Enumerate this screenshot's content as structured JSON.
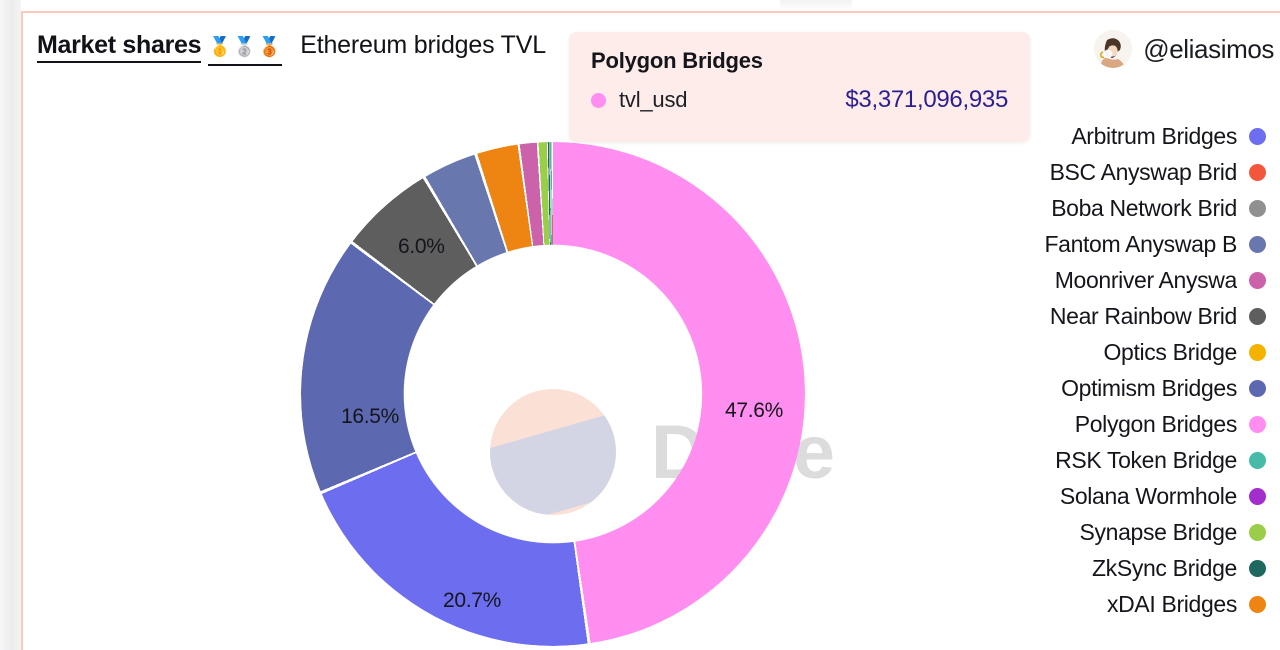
{
  "header": {
    "title_main": "Market shares",
    "title_medals": "🥇🥈🥉",
    "title_sub": "Ethereum bridges TVL",
    "author_handle": "@eliasimos"
  },
  "tooltip": {
    "title": "Polygon Bridges",
    "series_key": "tvl_usd",
    "series_dot_color": "#FF8EF0",
    "value": "$3,371,096,935"
  },
  "watermark": "Dune",
  "chart_data": {
    "type": "pie",
    "title": "Ethereum bridges TVL",
    "subtype": "donut",
    "value_label": "tvl_usd",
    "legend_position": "right",
    "categories": [
      "Polygon Bridges",
      "Arbitrum Bridges",
      "Optimism Bridges",
      "Near Rainbow Bridge",
      "Fantom Anyswap Bridge",
      "xDAI Bridges",
      "Moonriver Anyswap Bridge",
      "Synapse Bridge",
      "ZkSync Bridge",
      "RSK Token Bridge",
      "Boba Network Bridge",
      "BSC Anyswap Bridge",
      "Optics Bridge",
      "Solana Wormhole"
    ],
    "values": [
      47.6,
      20.7,
      16.5,
      6.0,
      3.4,
      2.6,
      1.1,
      0.6,
      0.5,
      0.4,
      0.25,
      0.2,
      0.1,
      0.05
    ],
    "value_unit": "percent",
    "colors": [
      "#FF8EF0",
      "#6D6DF0",
      "#5C68B0",
      "#5E5E5E",
      "#6878AE",
      "#EE8513",
      "#CC62AA",
      "#9BCE48",
      "#1F6860",
      "#45BBA8",
      "#909090",
      "#F4563C",
      "#F5B200",
      "#A32ECC"
    ],
    "visible_slice_labels": [
      {
        "text": "47.6%",
        "category": "Polygon Bridges"
      },
      {
        "text": "20.7%",
        "category": "Arbitrum Bridges"
      },
      {
        "text": "16.5%",
        "category": "Optimism Bridges"
      },
      {
        "text": "6.0%",
        "category": "Near Rainbow Bridge"
      }
    ],
    "hovered_slice": {
      "category": "Polygon Bridges",
      "value_usd": "$3,371,096,935"
    }
  },
  "slice_labels": {
    "polygon": "47.6%",
    "arbitrum": "20.7%",
    "optimism": "16.5%",
    "near": "6.0%"
  },
  "legend": {
    "items": [
      {
        "label": "Arbitrum Bridges",
        "color": "#6D6DF0"
      },
      {
        "label": "BSC Anyswap Brid",
        "color": "#F4563C"
      },
      {
        "label": "Boba Network Brid",
        "color": "#909090"
      },
      {
        "label": "Fantom Anyswap B",
        "color": "#6878AE"
      },
      {
        "label": "Moonriver Anyswa",
        "color": "#CC62AA"
      },
      {
        "label": "Near Rainbow Brid",
        "color": "#5E5E5E"
      },
      {
        "label": "Optics Bridge",
        "color": "#F5B200"
      },
      {
        "label": "Optimism Bridges",
        "color": "#5C68B0"
      },
      {
        "label": "Polygon Bridges",
        "color": "#FF8EF0"
      },
      {
        "label": "RSK Token Bridge",
        "color": "#45BBA8"
      },
      {
        "label": "Solana Wormhole",
        "color": "#A32ECC"
      },
      {
        "label": "Synapse Bridge",
        "color": "#9BCE48"
      },
      {
        "label": "ZkSync Bridge",
        "color": "#1F6860"
      },
      {
        "label": "xDAI Bridges",
        "color": "#EE8513"
      }
    ]
  }
}
